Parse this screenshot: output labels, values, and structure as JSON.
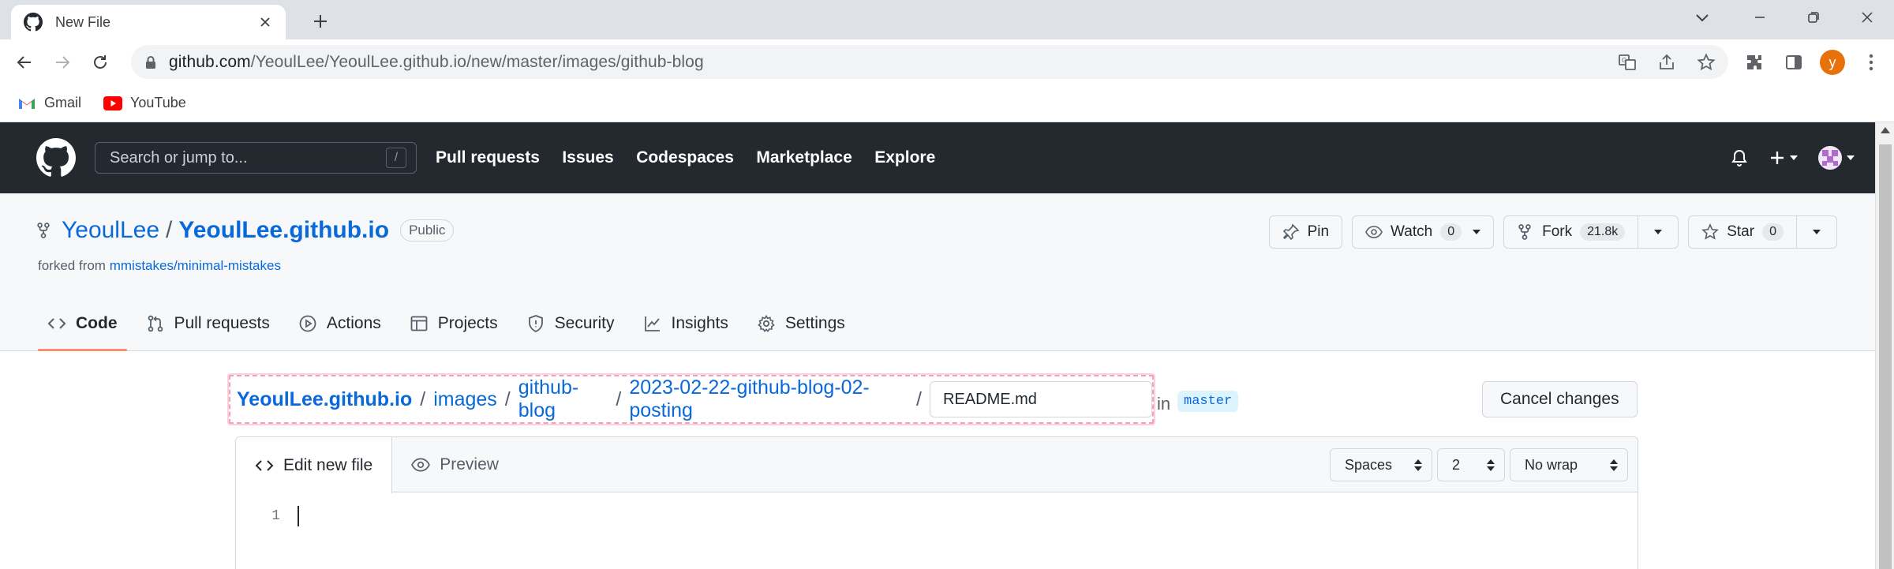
{
  "browser": {
    "tab_title": "New File",
    "url_host": "github.com",
    "url_path": "/YeoulLee/YeoulLee.github.io/new/master/images/github-blog",
    "profile_initial": "y",
    "bookmarks": [
      {
        "label": "Gmail",
        "icon": "gmail-icon"
      },
      {
        "label": "YouTube",
        "icon": "youtube-icon"
      }
    ]
  },
  "github": {
    "search_placeholder": "Search or jump to...",
    "search_shortcut": "/",
    "nav": [
      "Pull requests",
      "Issues",
      "Codespaces",
      "Marketplace",
      "Explore"
    ]
  },
  "repo": {
    "owner": "YeoulLee",
    "separator": "/",
    "name": "YeoulLee.github.io",
    "visibility": "Public",
    "forked_prefix": "forked from",
    "forked_source": "mmistakes/minimal-mistakes",
    "pin_label": "Pin",
    "watch_label": "Watch",
    "watch_count": "0",
    "fork_label": "Fork",
    "fork_count": "21.8k",
    "star_label": "Star",
    "star_count": "0",
    "tabs": [
      {
        "label": "Code",
        "icon": "code-icon",
        "active": true
      },
      {
        "label": "Pull requests",
        "icon": "pull-request-icon"
      },
      {
        "label": "Actions",
        "icon": "play-icon"
      },
      {
        "label": "Projects",
        "icon": "table-icon"
      },
      {
        "label": "Security",
        "icon": "shield-icon"
      },
      {
        "label": "Insights",
        "icon": "graph-icon"
      },
      {
        "label": "Settings",
        "icon": "gear-icon"
      }
    ]
  },
  "editor": {
    "breadcrumbs": [
      "YeoulLee.github.io",
      "images",
      "github-blog",
      "2023-02-22-github-blog-02-posting"
    ],
    "crumb_sep": "/",
    "filename_value": "README.md",
    "in_label": "in",
    "branch": "master",
    "cancel_label": "Cancel changes",
    "tab_edit": "Edit new file",
    "tab_preview": "Preview",
    "indent_mode": "Spaces",
    "indent_size": "2",
    "wrap_mode": "No wrap",
    "line_number": "1"
  },
  "colors": {
    "gh_header_bg": "#24292f",
    "link": "#0969da",
    "active_tab_underline": "#fd8c73",
    "highlight_border": "#f4a0b8"
  }
}
